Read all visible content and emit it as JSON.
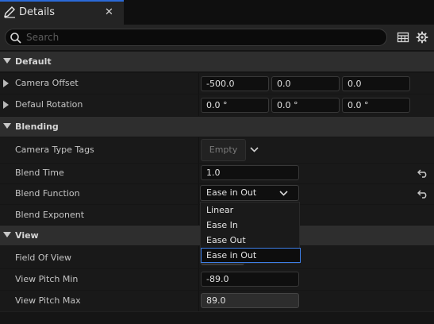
{
  "tab": {
    "title": "Details",
    "close": "✕",
    "icon": "pencil-icon"
  },
  "search": {
    "placeholder": "Search",
    "value": ""
  },
  "toolbar": {
    "icons": [
      "table-view-icon",
      "settings-gear-icon"
    ]
  },
  "sections": {
    "default": {
      "label": "Default"
    },
    "blending": {
      "label": "Blending"
    },
    "view": {
      "label": "View"
    }
  },
  "props": {
    "camera_offset": {
      "label": "Camera Offset",
      "values": [
        "-500.0",
        "0.0",
        "0.0"
      ]
    },
    "default_rotation": {
      "label": "Defaul Rotation",
      "values": [
        "0.0 °",
        "0.0 °",
        "0.0 °"
      ]
    },
    "camera_type_tags": {
      "label": "Camera Type Tags",
      "value": "Empty"
    },
    "blend_time": {
      "label": "Blend Time",
      "value": "1.0"
    },
    "blend_function": {
      "label": "Blend Function",
      "value": "Ease in Out"
    },
    "blend_exponent": {
      "label": "Blend Exponent"
    },
    "field_of_view": {
      "label": "Field Of View"
    },
    "view_pitch_min": {
      "label": "View Pitch Min",
      "value": "-89.0"
    },
    "view_pitch_max": {
      "label": "View Pitch Max",
      "value": "89.0"
    }
  },
  "blend_function_options": [
    "Linear",
    "Ease In",
    "Ease Out",
    "Ease in Out"
  ],
  "colors": {
    "accent": "#2b6ad8",
    "selection": "#3d7ee6",
    "category_bg": "#2e2e2e",
    "row_bg": "#191919"
  }
}
